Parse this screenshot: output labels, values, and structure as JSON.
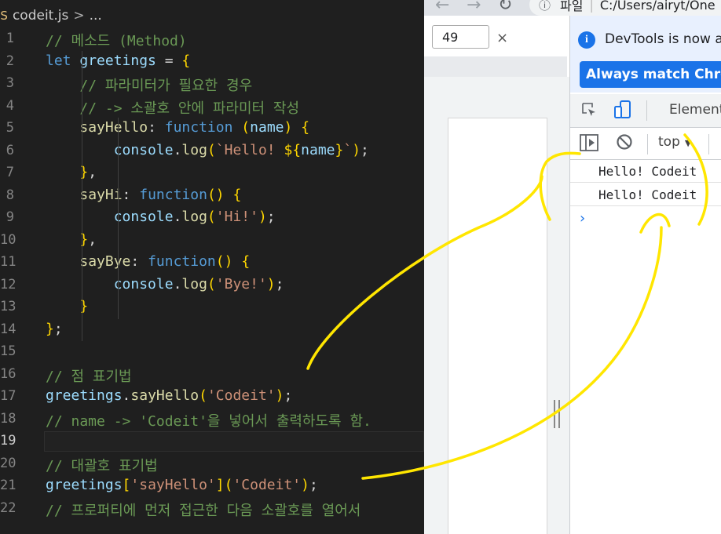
{
  "editor": {
    "breadcrumb": {
      "file": "codeit.js",
      "separator": ">",
      "ellipsis": "..."
    },
    "lines": [
      {
        "num": "1",
        "code": "// 메소드 (Method)"
      },
      {
        "num": "2",
        "code": "let greetings = {"
      },
      {
        "num": "3",
        "code": "    // 파라미터가 필요한 경우"
      },
      {
        "num": "4",
        "code": "    // -> 소괄호 안에 파라미터 작성"
      },
      {
        "num": "5",
        "code": "    sayHello: function (name) {"
      },
      {
        "num": "6",
        "code": "        console.log(`Hello! ${name}`);"
      },
      {
        "num": "7",
        "code": "    },"
      },
      {
        "num": "8",
        "code": "    sayHi: function() {"
      },
      {
        "num": "9",
        "code": "        console.log('Hi!');"
      },
      {
        "num": "10",
        "code": "    },"
      },
      {
        "num": "11",
        "code": "    sayBye: function() {"
      },
      {
        "num": "12",
        "code": "        console.log('Bye!');"
      },
      {
        "num": "13",
        "code": "    }"
      },
      {
        "num": "14",
        "code": "};"
      },
      {
        "num": "15",
        "code": ""
      },
      {
        "num": "16",
        "code": "// 점 표기법"
      },
      {
        "num": "17",
        "code": "greetings.sayHello('Codeit');"
      },
      {
        "num": "18",
        "code": "// name -> 'Codeit'을 넣어서 출력하도록 함."
      },
      {
        "num": "19",
        "code": ""
      },
      {
        "num": "20",
        "code": "// 대괄호 표기법"
      },
      {
        "num": "21",
        "code": "greetings['sayHello']('Codeit');"
      },
      {
        "num": "22",
        "code": "// 프로퍼티에 먼저 접근한 다음 소괄호를 열어서"
      }
    ],
    "current_line": "19"
  },
  "browser": {
    "address": {
      "scheme": "파일",
      "separator": "|",
      "path": "C:/Users/airyt/One"
    },
    "find": {
      "value": "49",
      "close": "×"
    }
  },
  "devtools": {
    "banner": {
      "text": "DevTools is now a",
      "button": "Always match Chron"
    },
    "tabs": {
      "elements": "Element"
    },
    "console": {
      "context": "top",
      "logs": [
        "Hello! Codeit",
        "Hello! Codeit"
      ],
      "prompt": ">"
    }
  },
  "colors": {
    "editor_bg": "#1f1f1f",
    "annotation": "#ffe600",
    "devtools_accent": "#1a73e8"
  }
}
